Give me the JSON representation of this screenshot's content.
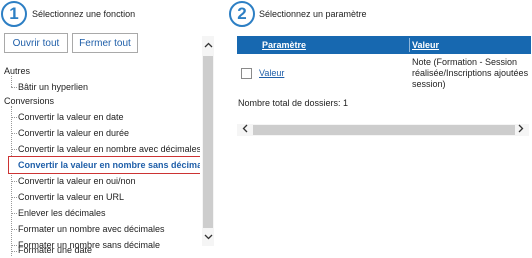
{
  "left_panel": {
    "step_number": "1",
    "title": "Sélectionnez une fonction",
    "open_all_label": "Ouvrir tout",
    "close_all_label": "Fermer tout",
    "categories": [
      {
        "label": "Autres",
        "items": [
          "Bâtir un hyperlien"
        ]
      },
      {
        "label": "Conversions",
        "items": [
          "Convertir la valeur en date",
          "Convertir la valeur en durée",
          "Convertir la valeur en nombre avec décimales",
          "Convertir la valeur en nombre sans décimales",
          "Convertir la valeur en oui/non",
          "Convertir la valeur en URL",
          "Enlever les décimales",
          "Formater un nombre avec décimales",
          "Formater un nombre sans décimale",
          "Formater une date"
        ]
      }
    ],
    "selected_item": "Convertir la valeur en nombre sans décimales"
  },
  "right_panel": {
    "step_number": "2",
    "title": "Sélectionnez un paramètre",
    "columns": [
      "Paramètre",
      "Valeur"
    ],
    "rows": [
      {
        "parametre": "Valeur",
        "valeur_lines": [
          "Note (Formation - Session",
          "réalisée/Inscriptions ajoutées dans la",
          "session)"
        ]
      }
    ],
    "total_label": "Nombre total de dossiers: 1"
  },
  "icons": {
    "scroll_up": "chevron-up-icon",
    "scroll_down": "chevron-down-icon",
    "scroll_left": "chevron-left-icon",
    "scroll_right": "chevron-right-icon"
  }
}
